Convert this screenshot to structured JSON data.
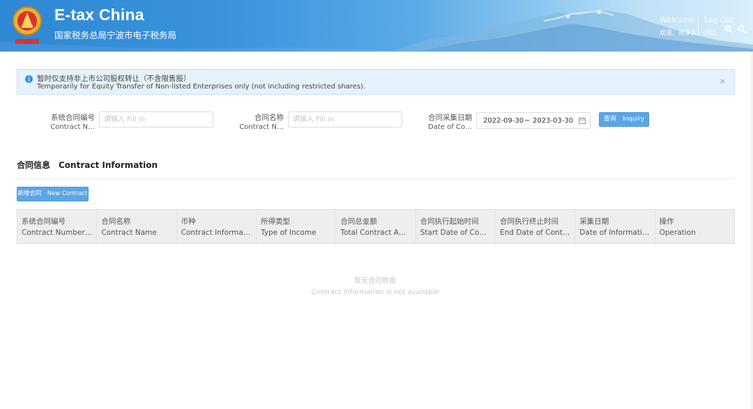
{
  "header": {
    "title": "E-tax China",
    "subtitle": "国家税务总局宁波市电子税务局",
    "welcome_label": "Welcome",
    "welcome_user": "欢迎，肖多久",
    "logout_label": "Log Out",
    "logout_zh": "退出",
    "colors": {
      "primary": "#2f88d4"
    }
  },
  "notice": {
    "line_zh": "暂时仅支持非上市公司股权转让（不含限售股）",
    "line_en": "Temporarily for Equity Transfer of Non-listed Enterprises only (not including restricted shares).",
    "close_icon": "×"
  },
  "form": {
    "contract_no": {
      "label_zh": "系统合同编号",
      "label_en": "Contract N…",
      "placeholder": "请输入 Fill in",
      "value": ""
    },
    "contract_name": {
      "label_zh": "合同名称",
      "label_en": "Contract N…",
      "placeholder": "请输入 Fill in",
      "value": ""
    },
    "collect_date": {
      "label_zh": "合同采集日期",
      "label_en": "Date of Co…",
      "start": "2022-09-30",
      "separator": "~",
      "end": "2023-03-30"
    },
    "query_button": "查询　Inquiry"
  },
  "section": {
    "title": "合同信息　Contract Information",
    "new_button": "新增合同　New Contract"
  },
  "table": {
    "columns": [
      {
        "zh": "系统合同编号",
        "en": "Contract Number i..."
      },
      {
        "zh": "合同名称",
        "en": "Contract Name"
      },
      {
        "zh": "币种",
        "en": "Contract Informati..."
      },
      {
        "zh": "所得类型",
        "en": "Type of Income"
      },
      {
        "zh": "合同总金额",
        "en": "Total Contract Am..."
      },
      {
        "zh": "合同执行起始时间",
        "en": "Start Date of Contr..."
      },
      {
        "zh": "合同执行终止时间",
        "en": "End Date of Contr..."
      },
      {
        "zh": "采集日期",
        "en": "Date of Informatio..."
      },
      {
        "zh": "操作",
        "en": "Operation"
      }
    ],
    "empty_zh": "暂无合同数据",
    "empty_en": "Contract Information is not available"
  }
}
